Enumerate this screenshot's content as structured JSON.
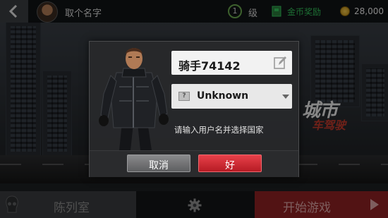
{
  "topbar": {
    "player_name": "取个名字",
    "level_value": "1",
    "level_label": "级",
    "reward_label": "金币奖励",
    "coins": "28,000"
  },
  "background": {
    "logo_line1": "城市",
    "logo_line2": "车驾驶"
  },
  "dialog": {
    "name_value": "骑手74142",
    "flag_glyph": "?",
    "country": "Unknown",
    "hint": "请输入用户名并选择国家",
    "cancel_label": "取消",
    "ok_label": "好"
  },
  "bottombar": {
    "garage_label": "陈列室",
    "start_label": "开始游戏"
  },
  "colors": {
    "accent_red": "#e8414a",
    "reward_green": "#33c15a",
    "start_bg": "#8e2224"
  }
}
